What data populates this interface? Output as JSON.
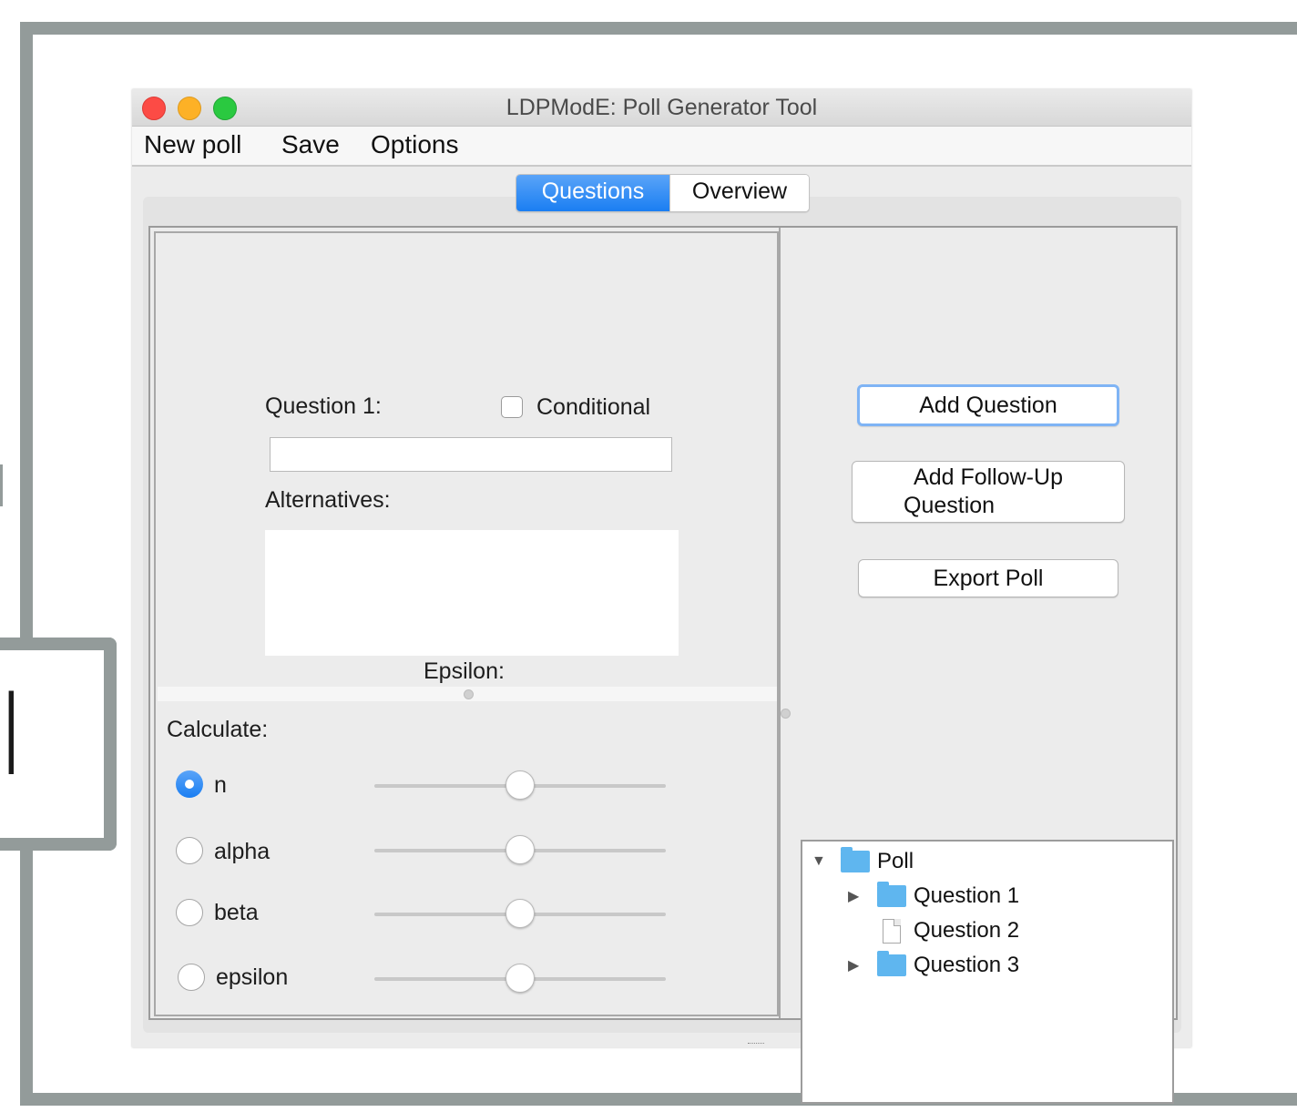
{
  "window": {
    "title": "LDPModE: Poll Generator Tool"
  },
  "callout": {
    "glyph": "l"
  },
  "menu": {
    "items": [
      "New poll",
      "Save",
      "Options"
    ]
  },
  "tabs": [
    {
      "label": "Questions",
      "active": true
    },
    {
      "label": "Overview",
      "active": false
    }
  ],
  "question_form": {
    "question_label": "Question 1:",
    "question_value": "",
    "conditional_label": "Conditional",
    "conditional_checked": false,
    "alternatives_label": "Alternatives:",
    "alternatives_value": "",
    "epsilon_label": "Epsilon:"
  },
  "calculate": {
    "label": "Calculate:",
    "options": [
      {
        "label": "n",
        "selected": true,
        "slider_value": 0.5
      },
      {
        "label": "alpha",
        "selected": false,
        "slider_value": 0.5
      },
      {
        "label": "beta",
        "selected": false,
        "slider_value": 0.5
      },
      {
        "label": "epsilon",
        "selected": false,
        "slider_value": 0.5
      }
    ]
  },
  "actions": {
    "add_question": "Add Question",
    "add_follow_up_line1": "Add Follow-Up",
    "add_follow_up_line2": "Question",
    "export_poll": "Export Poll"
  },
  "tree": {
    "root": {
      "label": "Poll",
      "expanded": true,
      "icon": "folder-icon"
    },
    "children": [
      {
        "label": "Question 1",
        "icon": "folder-icon",
        "has_children": true
      },
      {
        "label": "Question 2",
        "icon": "document-icon",
        "has_children": false
      },
      {
        "label": "Question 3",
        "icon": "folder-icon",
        "has_children": true
      }
    ]
  },
  "colors": {
    "accent": "#1a7ef2",
    "frame": "#939b9a",
    "folder": "#5fb6ef"
  }
}
